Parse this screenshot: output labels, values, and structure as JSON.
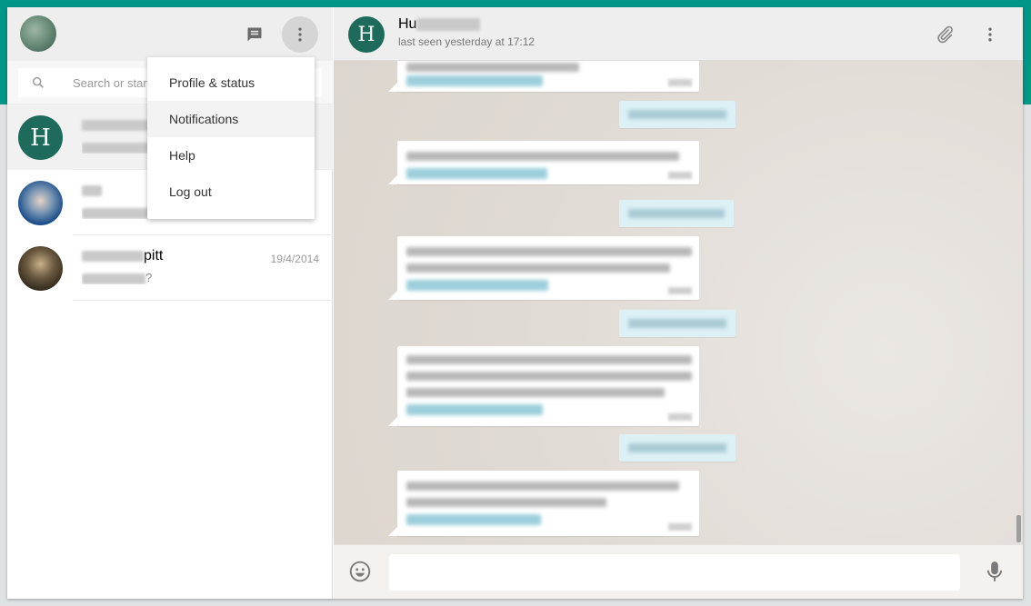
{
  "left_header": {
    "new_chat_icon": "message-icon",
    "menu_icon": "vertical-dots-icon"
  },
  "search": {
    "placeholder": "Search or start new chat"
  },
  "chats": [
    {
      "name": "",
      "time": "",
      "preview": "",
      "avatar_letter": "H"
    },
    {
      "name": "",
      "time": "",
      "preview": "",
      "avatar_letter": ""
    },
    {
      "name": "pitt",
      "time": "19/4/2014",
      "preview": "?",
      "avatar_letter": ""
    }
  ],
  "menu": {
    "items": [
      "Profile & status",
      "Notifications",
      "Help",
      "Log out"
    ]
  },
  "conversation": {
    "contact_initial": "H",
    "contact_name": "Hu",
    "last_seen": "last seen yesterday at 17:12"
  },
  "composer": {
    "placeholder": ""
  },
  "colors": {
    "accent": "#009688",
    "avatar": "#1f6b5b",
    "outgoing_bubble": "#dcf0f5"
  }
}
